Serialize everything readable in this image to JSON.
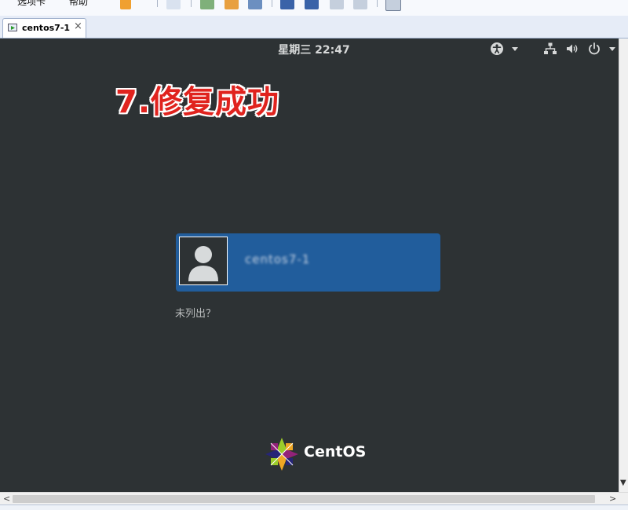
{
  "host": {
    "menu_items": [
      "选项卡",
      "帮助"
    ],
    "tab": {
      "label": "centos7-1",
      "close": "×"
    }
  },
  "guest": {
    "clock": "星期三 22:47",
    "annotation": "7.修复成功",
    "user": {
      "name": "centos7-1"
    },
    "not_listed": "未列出？",
    "brand": "CentOS"
  },
  "scrollbars": {
    "left_arrow": "<",
    "right_arrow": ">",
    "down_arrow": "▼"
  },
  "colors": {
    "background": "#2d3234",
    "user_tile": "#215d9c",
    "annotation": "#e0231e"
  }
}
